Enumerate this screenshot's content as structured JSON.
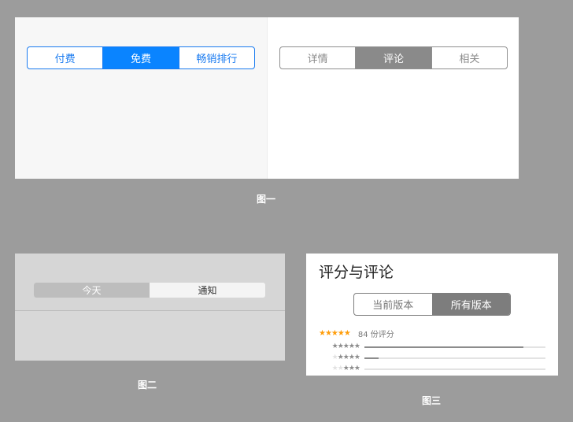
{
  "figure1": {
    "caption": "图一",
    "blue_segments": [
      {
        "label": "付费",
        "active": false
      },
      {
        "label": "免费",
        "active": true
      },
      {
        "label": "畅销排行",
        "active": false
      }
    ],
    "gray_segments": [
      {
        "label": "详情",
        "active": false
      },
      {
        "label": "评论",
        "active": true
      },
      {
        "label": "相关",
        "active": false
      }
    ]
  },
  "figure2": {
    "caption": "图二",
    "segments": [
      {
        "label": "今天",
        "active": true
      },
      {
        "label": "通知",
        "active": false
      }
    ]
  },
  "figure3": {
    "caption": "图三",
    "title": "评分与评论",
    "segments": [
      {
        "label": "当前版本",
        "active": false
      },
      {
        "label": "所有版本",
        "active": true
      }
    ],
    "rating_count": "84 份评分",
    "distribution": [
      {
        "stars": 5,
        "fraction": 0.88
      },
      {
        "stars": 4,
        "fraction": 0.08
      },
      {
        "stars": 3,
        "fraction": 0.0
      }
    ]
  },
  "colors": {
    "blue_accent": "#0a84ff",
    "gray_accent": "#8a8a8a",
    "star_orange": "#ff9d0a",
    "background": "#9c9c9c"
  }
}
